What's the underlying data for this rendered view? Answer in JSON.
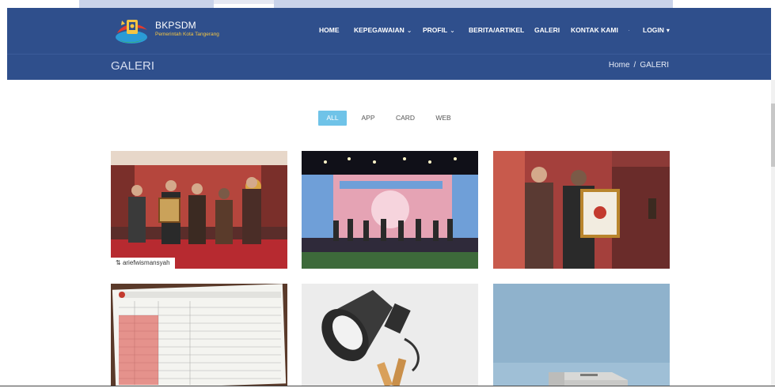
{
  "brand": {
    "name": "BKPSDM",
    "subtitle": "Pemerintah Kota Tangerang"
  },
  "nav": {
    "items": [
      {
        "label": "HOME"
      },
      {
        "label": "KEPEGAWAIAN"
      },
      {
        "label": "PROFIL"
      },
      {
        "label": "BERITA/ARTIKEL"
      },
      {
        "label": "GALERI"
      },
      {
        "label": "KONTAK KAMI"
      },
      {
        "label": "LOGIN"
      }
    ]
  },
  "page": {
    "title": "GALERI",
    "breadcrumb": {
      "home": "Home",
      "separator": "/",
      "current": "GALERI"
    }
  },
  "filters": {
    "items": [
      {
        "label": "ALL",
        "active": true
      },
      {
        "label": "APP"
      },
      {
        "label": "CARD"
      },
      {
        "label": "WEB"
      }
    ]
  },
  "gallery": {
    "credit": "ariefwismansyah"
  },
  "colors": {
    "header": "#2f4f8c",
    "filter_active": "#6fc3e8"
  }
}
